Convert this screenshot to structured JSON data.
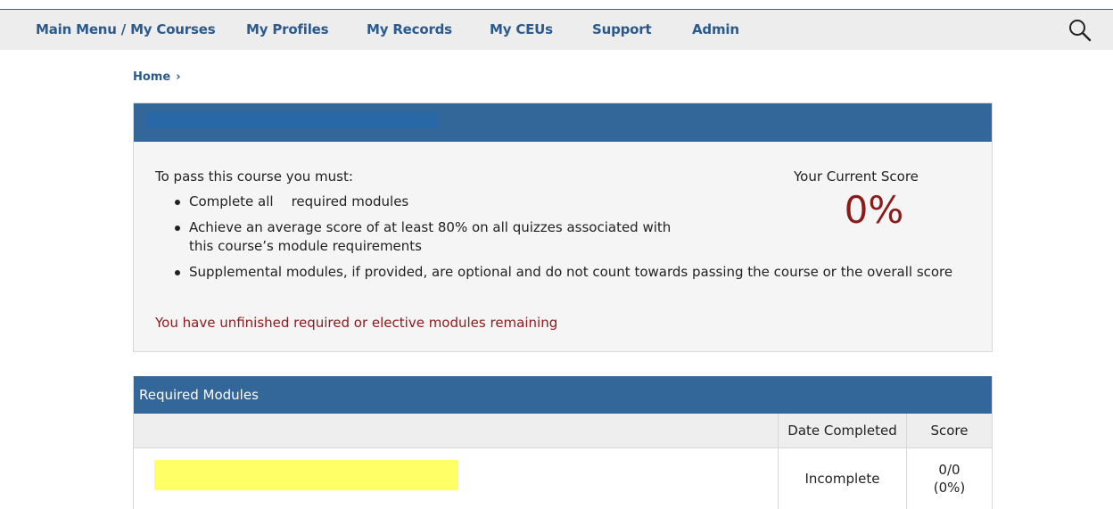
{
  "nav": {
    "items": [
      {
        "label": "Main Menu / My Courses"
      },
      {
        "label": "My Profiles"
      },
      {
        "label": "My Records"
      },
      {
        "label": "My CEUs"
      },
      {
        "label": "Support"
      },
      {
        "label": "Admin"
      }
    ],
    "search_icon": "search-icon"
  },
  "breadcrumb": {
    "home": "Home",
    "separator": "›"
  },
  "course": {
    "requirements_intro": "To pass this course you must:",
    "requirements": [
      {
        "before": "Complete all",
        "after": "required modules"
      },
      {
        "text": "Achieve an average score of at least 80% on all quizzes associated with this course’s module requirements"
      },
      {
        "text": "Supplemental modules, if provided, are optional and do not count towards passing the course or the overall score"
      }
    ],
    "warning": "You have unfinished required or elective modules remaining",
    "score_label": "Your Current Score",
    "score_value": "0%"
  },
  "modules": {
    "title": "Required Modules",
    "columns": {
      "date": "Date Completed",
      "score": "Score"
    },
    "rows": [
      {
        "date": "Incomplete",
        "score_fraction": "0/0",
        "score_percent": "(0%)"
      }
    ]
  },
  "colors": {
    "header_blue": "#336699",
    "nav_text": "#2b5a8c",
    "alert_red": "#8b1a1a",
    "highlight_yellow": "#ffff66"
  }
}
